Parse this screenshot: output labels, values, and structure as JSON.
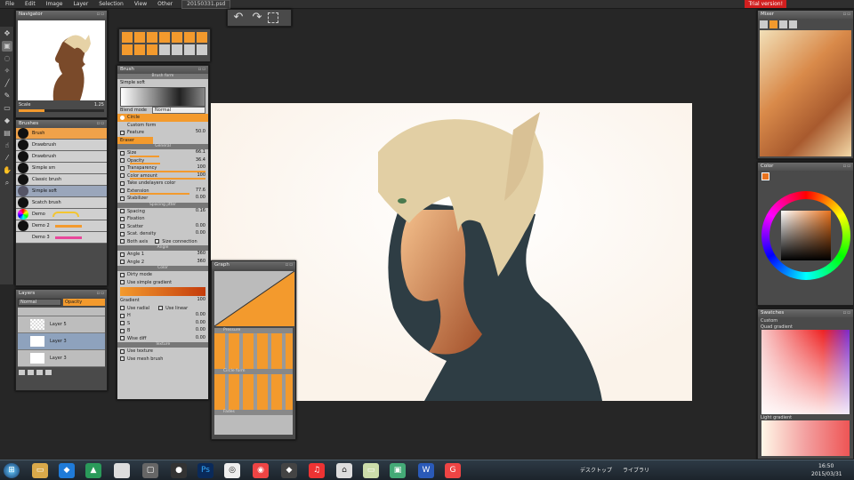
{
  "menubar": {
    "items": [
      "File",
      "Edit",
      "Image",
      "Layer",
      "Selection",
      "View",
      "Other"
    ],
    "document_tab": "20150331.psd",
    "trial_badge": "Trial version!"
  },
  "navigator": {
    "title": "Navigator",
    "zoom_label": "Scale",
    "zoom_value": "1.25"
  },
  "brushes": {
    "title": "Brushes",
    "items": [
      "Brush",
      "Drawbrush",
      "Drawbrush",
      "Simple sm",
      "Classic brush",
      "Simple soft",
      "Scatch brush",
      "Demo",
      "Demo 2",
      "Demo 3"
    ]
  },
  "layers": {
    "title": "Layers",
    "blend_mode": "Normal",
    "opacity_label": "Opacity",
    "items": [
      "Layer 5",
      "Layer 3",
      "Layer 3"
    ]
  },
  "brush_panel": {
    "title": "Brush",
    "header": "Brush form",
    "brush_name": "Simple soft",
    "blend_mode_label": "Blend mode",
    "blend_mode_value": "Normal",
    "shape_label": "Circle",
    "custom_form": "Custom form",
    "feature_label": "Feature",
    "feature_value": "50.0",
    "eraser_label": "Eraser",
    "sections": {
      "general": "General",
      "spacing": "Spacing jitter",
      "angle": "Angle",
      "color": "Color",
      "texture": "Texture"
    },
    "sliders": [
      {
        "label": "Size",
        "value": "66.1",
        "fill": 0.35
      },
      {
        "label": "Opacity",
        "value": "36.4",
        "fill": 0.36
      },
      {
        "label": "Transparency",
        "value": "100",
        "fill": 1.0
      },
      {
        "label": "Color amount",
        "value": "100",
        "fill": 1.0
      },
      {
        "label": "Take undelayers color",
        "value": "",
        "fill": 0
      },
      {
        "label": "Extension",
        "value": "77.6",
        "fill": 0.77
      },
      {
        "label": "Stabilizer",
        "value": "0.00",
        "fill": 0
      }
    ],
    "spacing_rows": [
      {
        "label": "Spacing",
        "value": "0.16"
      },
      {
        "label": "Fixation",
        "value": ""
      },
      {
        "label": "Scatter",
        "value": "0.00"
      },
      {
        "label": "Scat. density",
        "value": "0.00"
      }
    ],
    "both_axis": "Both axis",
    "size_connection": "Size connection",
    "angle_rows": [
      {
        "label": "Angle 1",
        "value": "360"
      },
      {
        "label": "Angle 2",
        "value": "360"
      }
    ],
    "color_rows": [
      "Dirty mode",
      "Use simple gradient"
    ],
    "gradient_label": "Gradient",
    "gradient_value": "100",
    "use_radial": "Use radial",
    "use_linear": "Use linear",
    "hsb_rows": [
      {
        "label": "H",
        "value": "0.00"
      },
      {
        "label": "S",
        "value": "0.00"
      },
      {
        "label": "B",
        "value": "0.00"
      },
      {
        "label": "Wise diff",
        "value": "0.00"
      }
    ],
    "texture_rows": [
      "Use texture",
      "Use mesh brush"
    ]
  },
  "graph": {
    "title": "Graph",
    "items": [
      "Pressure",
      "Circle form",
      "Fades"
    ]
  },
  "mixer": {
    "title": "Mixer"
  },
  "color": {
    "title": "Color"
  },
  "swatches": {
    "title": "Swatches",
    "items": [
      "Custom",
      "Quad gradient",
      "Light gradient"
    ]
  },
  "taskbar": {
    "lang": "デスクトップ",
    "library": "ライブラリ",
    "time": "16:50",
    "date": "2015/03/31"
  },
  "colors": {
    "accent": "#f39a2d",
    "panel": "#4a4a4a",
    "bg": "#262626"
  }
}
